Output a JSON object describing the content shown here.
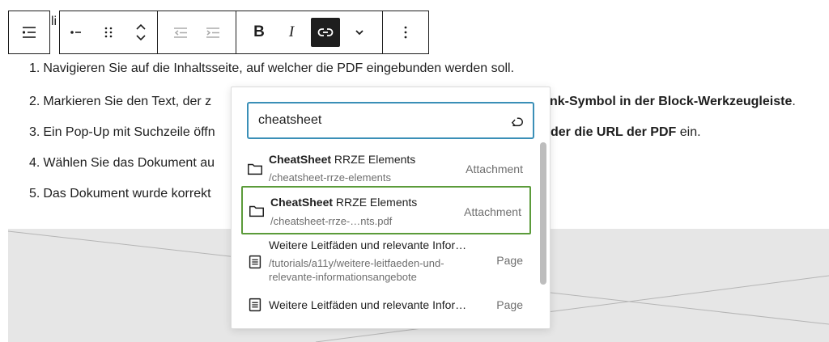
{
  "toolbar": {
    "partial_text": "li",
    "buttons": [
      "list-view",
      "list-style",
      "drag",
      "move-up",
      "move-down",
      "outdent",
      "indent",
      "Bold",
      "Italic",
      "Link",
      "More",
      "Options"
    ],
    "bold_label": "B",
    "italic_label": "I"
  },
  "list": {
    "items": [
      {
        "num": "1.",
        "text": "Navigieren Sie auf die Inhaltsseite, auf welcher die PDF eingebunden werden soll."
      },
      {
        "num": "2.",
        "text_a": "Markieren Sie den Text, der z",
        "text_b": "nk-Symbol in der Block-Werkzeugleiste",
        "text_c": "."
      },
      {
        "num": "3.",
        "text_a": "Ein Pop-Up mit Suchzeile öffn",
        "text_b": "der die URL der PDF",
        "text_c": " ein."
      },
      {
        "num": "4.",
        "text": "Wählen Sie das Dokument au"
      },
      {
        "num": "5.",
        "text": "Das Dokument wurde korrekt"
      }
    ]
  },
  "popover": {
    "search_value": "cheatsheet",
    "results": [
      {
        "title_bold": "CheatSheet",
        "title_rest": " RRZE Elements",
        "url": "/cheatsheet-rrze-elements",
        "type": "Attachment",
        "icon": "folder-icon",
        "selected": false
      },
      {
        "title_bold": "CheatSheet",
        "title_rest": " RRZE Elements",
        "url": "/cheatsheet-rrze-…nts.pdf",
        "type": "Attachment",
        "icon": "folder-icon",
        "selected": true
      },
      {
        "title_bold": "",
        "title_rest": "Weitere Leitfäden und relevante Infor…",
        "url_line1": "/tutorials/a11y/weitere-leitfaeden-und-",
        "url_line2": "relevante-informationsangebote",
        "type": "Page",
        "icon": "page-icon",
        "selected": false
      },
      {
        "title_bold": "",
        "title_rest": "Weitere Leitfäden und relevante Infor…",
        "type": "Page",
        "icon": "page-icon",
        "selected": false
      }
    ]
  },
  "colors": {
    "accent": "#3a8fb7",
    "selected_border": "#5b9b3a",
    "toolbar_dark": "#1e1e1e"
  }
}
